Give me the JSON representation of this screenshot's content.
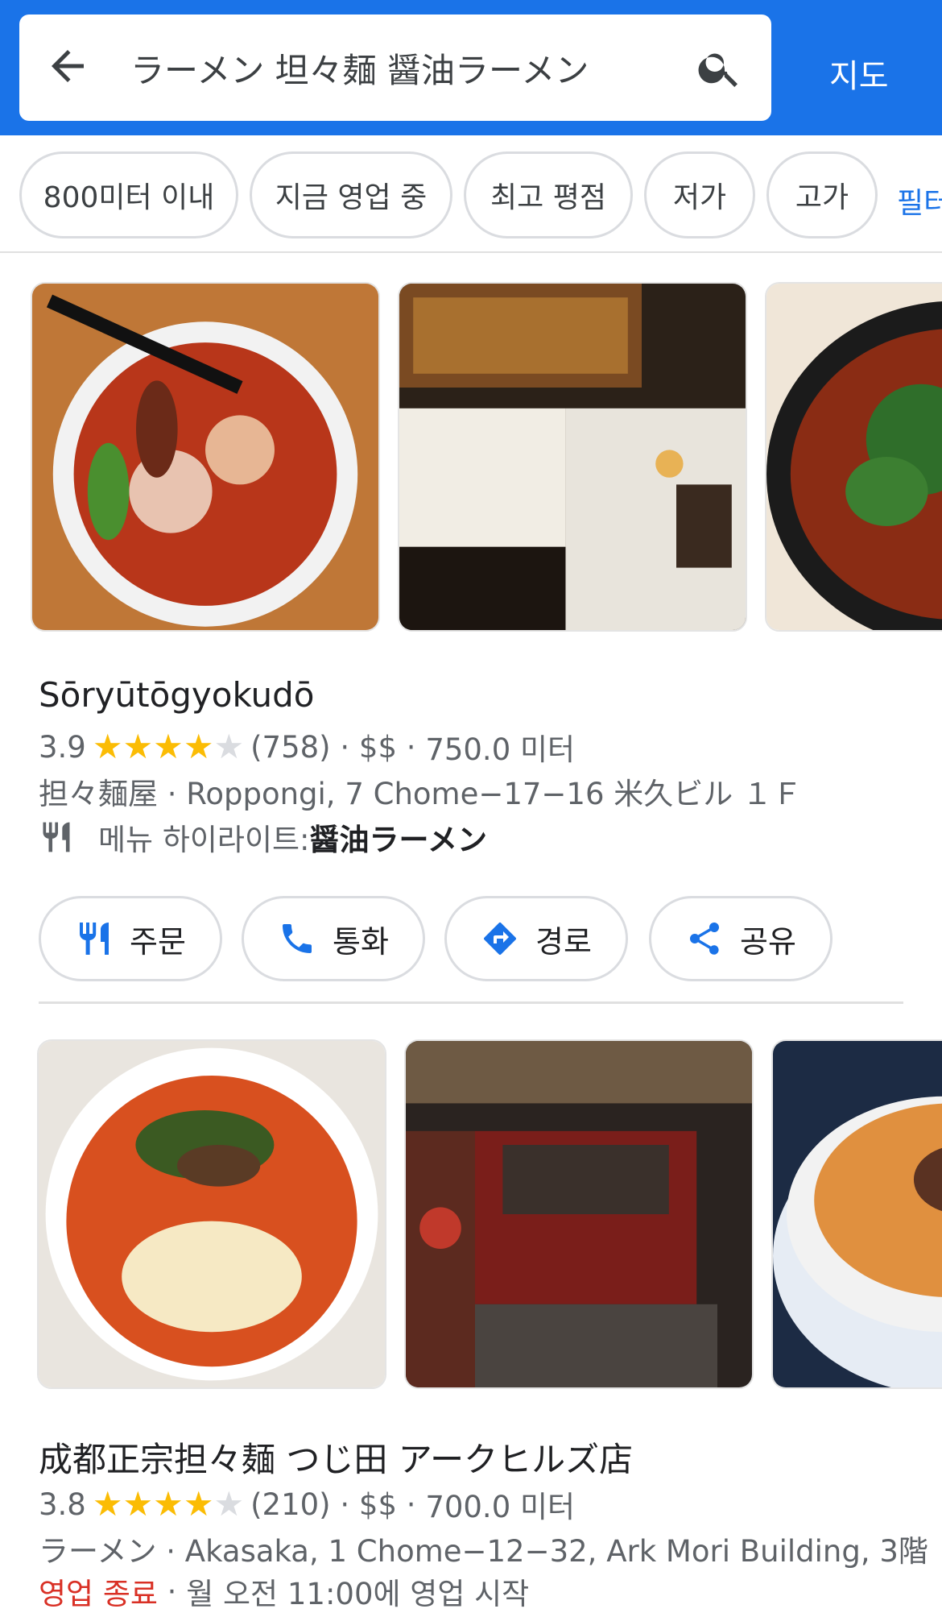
{
  "header": {
    "query": "ラーメン 坦々麺 醤油ラーメン",
    "map_label": "지도"
  },
  "filters": {
    "chips": [
      "800미터 이내",
      "지금 영업 중",
      "최고 평점",
      "저가",
      "고가"
    ],
    "more_label": "필터"
  },
  "results": [
    {
      "name": "Sōryūtōgyokudō",
      "rating": "3.9",
      "stars_filled": 4,
      "reviews": "(758)",
      "price": "$$",
      "distance": "750.0 미터",
      "category_address": "担々麺屋 · Roppongi, 7 Chome−17−16 米久ビル １Ｆ",
      "menu_prefix": "메뉴 하이라이트: ",
      "menu_item": "醤油ラーメン",
      "photos": [
        "ramen-bowl",
        "storefront",
        "tantanmen-bowl"
      ]
    },
    {
      "name": "成都正宗担々麺 つじ田 アークヒルズ店",
      "rating": "3.8",
      "stars_filled": 4,
      "reviews": "(210)",
      "price": "$$",
      "distance": "700.0 미터",
      "category_address": "ラーメン · Akasaka, 1 Chome−12−32, Ark Mori Building, 3階",
      "status": "영업 종료",
      "hours": "월 오전 11:00에 영업 시작",
      "photos": [
        "tantanmen-bowl",
        "restaurant-interior",
        "tantanmen-bowl"
      ]
    }
  ],
  "actions": {
    "order": "주문",
    "call": "통화",
    "directions": "경로",
    "share": "공유"
  },
  "colors": {
    "header_bg": "#1a73e8",
    "star": "#fbbc04",
    "icon_blue": "#1a73e8",
    "closed_red": "#d93025"
  }
}
